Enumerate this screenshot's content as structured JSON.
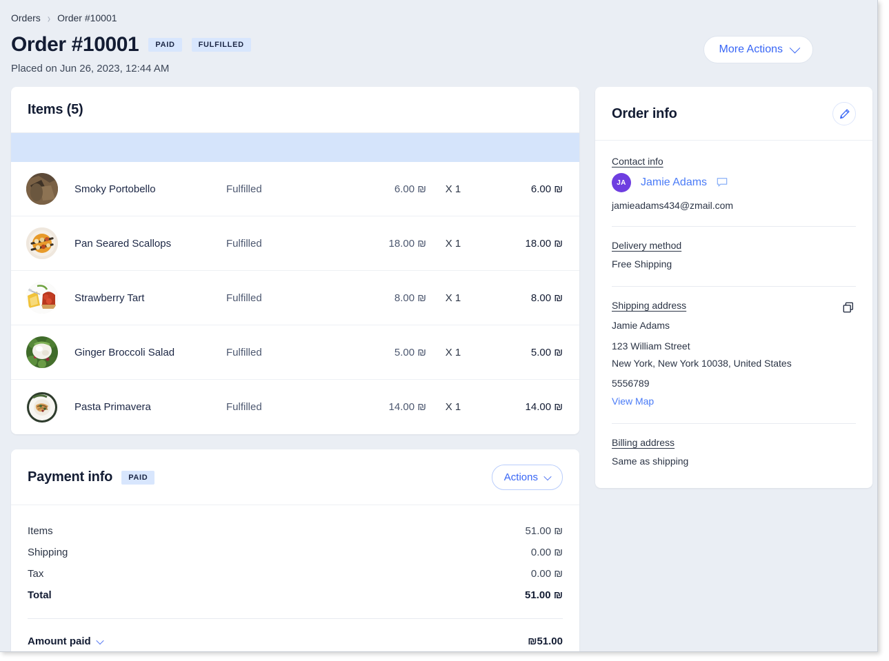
{
  "breadcrumb": {
    "root": "Orders",
    "current": "Order #10001"
  },
  "header": {
    "title": "Order #10001",
    "badge_paid": "PAID",
    "badge_fulfilled": "FULFILLED",
    "placed": "Placed on Jun 26, 2023, 12:44 AM",
    "more_actions": "More Actions"
  },
  "items_card": {
    "title": "Items (5)",
    "rows": [
      {
        "name": "Smoky Portobello",
        "status": "Fulfilled",
        "price": "6.00 ₪",
        "qty": "X 1",
        "total": "6.00 ₪",
        "thumb": "mushroom-thumb"
      },
      {
        "name": "Pan Seared Scallops",
        "status": "Fulfilled",
        "price": "18.00 ₪",
        "qty": "X 1",
        "total": "18.00 ₪",
        "thumb": "scallops-thumb"
      },
      {
        "name": "Strawberry Tart",
        "status": "Fulfilled",
        "price": "8.00 ₪",
        "qty": "X 1",
        "total": "8.00 ₪",
        "thumb": "tart-thumb"
      },
      {
        "name": "Ginger Broccoli Salad",
        "status": "Fulfilled",
        "price": "5.00 ₪",
        "qty": "X 1",
        "total": "5.00 ₪",
        "thumb": "salad-thumb"
      },
      {
        "name": "Pasta Primavera",
        "status": "Fulfilled",
        "price": "14.00 ₪",
        "qty": "X 1",
        "total": "14.00 ₪",
        "thumb": "pasta-thumb"
      }
    ]
  },
  "payment_card": {
    "title": "Payment info",
    "badge": "PAID",
    "actions_label": "Actions",
    "lines": [
      {
        "label": "Items",
        "amount": "51.00 ₪"
      },
      {
        "label": "Shipping",
        "amount": "0.00 ₪"
      },
      {
        "label": "Tax",
        "amount": "0.00 ₪"
      },
      {
        "label": "Total",
        "amount": "51.00 ₪"
      }
    ],
    "amount_paid_label": "Amount paid",
    "amount_paid_value": "₪51.00"
  },
  "order_info": {
    "title": "Order info",
    "contact_label": "Contact info",
    "avatar_initials": "JA",
    "contact_name": "Jamie Adams",
    "email": "jamieadams434@zmail.com",
    "delivery_label": "Delivery method",
    "delivery_value": "Free Shipping",
    "shipping_label": "Shipping address",
    "shipping_name": "Jamie Adams",
    "shipping_street": "123 William Street",
    "shipping_city": "New York, New York 10038, United States",
    "shipping_phone": "5556789",
    "view_map": "View Map",
    "billing_label": "Billing address",
    "billing_value": "Same as shipping"
  },
  "colors": {
    "accent_blue": "#3765f5",
    "badge_bg": "#d8e6fd",
    "highlight_band": "#d5e4fb",
    "avatar_purple": "#6e3ee0",
    "page_bg": "#eaeef4"
  }
}
